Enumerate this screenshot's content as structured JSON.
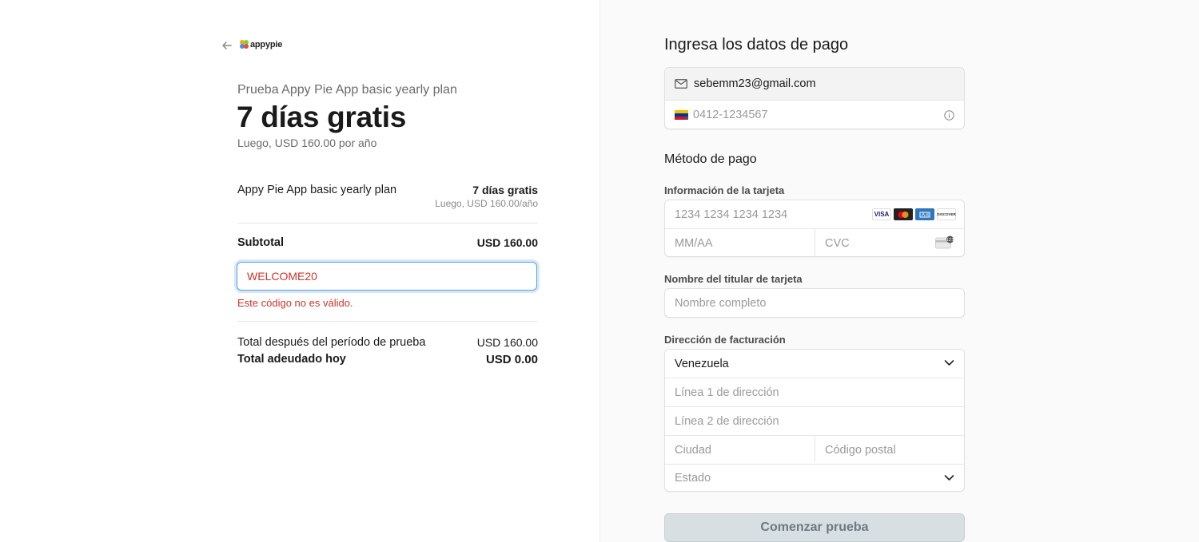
{
  "brand": {
    "logo_text": "appypie"
  },
  "summary": {
    "subtitle": "Prueba Appy Pie App basic yearly plan",
    "headline": "7 días gratis",
    "then": "Luego, USD 160.00 por año",
    "line_item": {
      "name": "Appy Pie App basic yearly plan",
      "price": "7 días gratis",
      "price_sub": "Luego, USD 160.00/año"
    },
    "subtotal_label": "Subtotal",
    "subtotal_value": "USD 160.00",
    "promo_code": "WELCOME20",
    "promo_error": "Este código no es válido.",
    "total_after_label": "Total después del período de prueba",
    "total_after_value": "USD 160.00",
    "total_today_label": "Total adeudado hoy",
    "total_today_value": "USD 0.00"
  },
  "payment": {
    "title": "Ingresa los datos de pago",
    "email": "sebemm23@gmail.com",
    "phone_placeholder": "0412-1234567",
    "method_title": "Método de pago",
    "card_label": "Información de la tarjeta",
    "card_number_placeholder": "1234 1234 1234 1234",
    "expiry_placeholder": "MM/AA",
    "cvc_placeholder": "CVC",
    "card_brands": [
      "VISA",
      "DISCOVER"
    ],
    "holder_label": "Nombre del titular de tarjeta",
    "holder_placeholder": "Nombre completo",
    "billing_label": "Dirección de facturación",
    "country": "Venezuela",
    "address1_placeholder": "Línea 1 de dirección",
    "address2_placeholder": "Línea 2 de dirección",
    "city_placeholder": "Ciudad",
    "postal_placeholder": "Código postal",
    "state_placeholder": "Estado",
    "submit_label": "Comenzar prueba"
  },
  "colors": {
    "error": "#d0342c",
    "focus": "#5aa0e6",
    "button_bg": "#d8dfe3"
  }
}
